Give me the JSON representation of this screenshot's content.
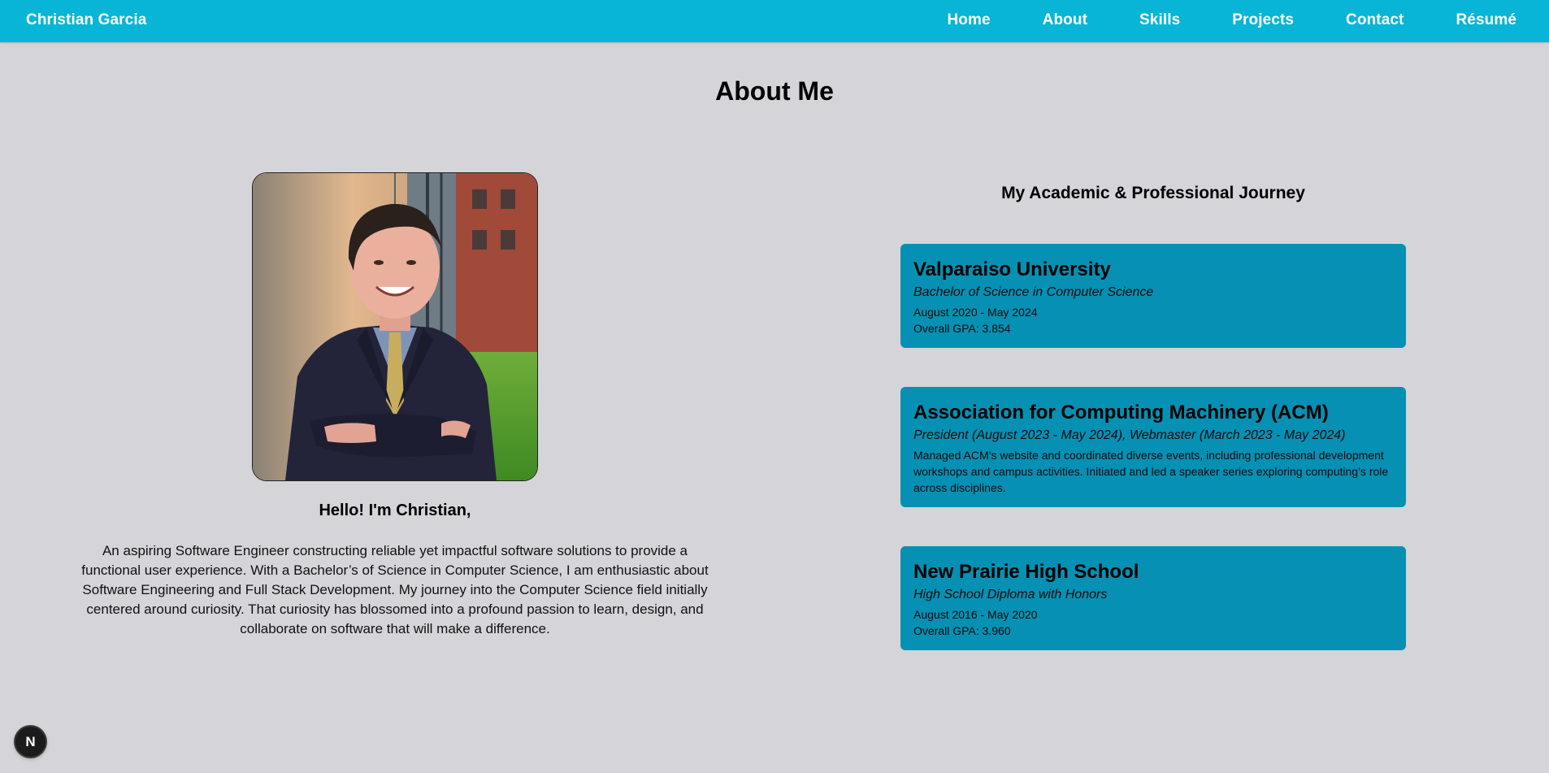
{
  "nav": {
    "brand": "Christian Garcia",
    "links": [
      "Home",
      "About",
      "Skills",
      "Projects",
      "Contact",
      "Résumé"
    ]
  },
  "about": {
    "title": "About Me",
    "greeting": "Hello! I'm Christian,",
    "bio": "An aspiring Software Engineer constructing reliable yet impactful software solutions to provide a functional user experience. With a Bachelor’s of Science in Computer Science, I am enthusiastic about Software Engineering and Full Stack Development. My journey into the Computer Science field initially centered around curiosity. That curiosity has blossomed into a profound passion to learn, design, and collaborate on software that will make a difference."
  },
  "journey": {
    "title": "My Academic & Professional Journey",
    "cards": [
      {
        "title": "Valparaiso University",
        "subtitle": "Bachelor of Science in Computer Science",
        "line1": "August 2020 - May 2024",
        "line2": "Overall GPA: 3.854"
      },
      {
        "title": "Association for Computing Machinery (ACM)",
        "subtitle": "President (August 2023 - May 2024), Webmaster (March 2023 - May 2024)",
        "line1": "Managed ACM’s website and coordinated diverse events, including professional development workshops and campus activities. Initiated and led a speaker series exploring computing’s role across disciplines."
      },
      {
        "title": "New Prairie High School",
        "subtitle": "High School Diploma with Honors",
        "line1": "August 2016 - May 2020",
        "line2": "Overall GPA: 3.960"
      }
    ]
  },
  "dev_badge": "N",
  "colors": {
    "navbar": "#08b5d6",
    "card": "#0690b3",
    "background": "#d5d5d9"
  }
}
